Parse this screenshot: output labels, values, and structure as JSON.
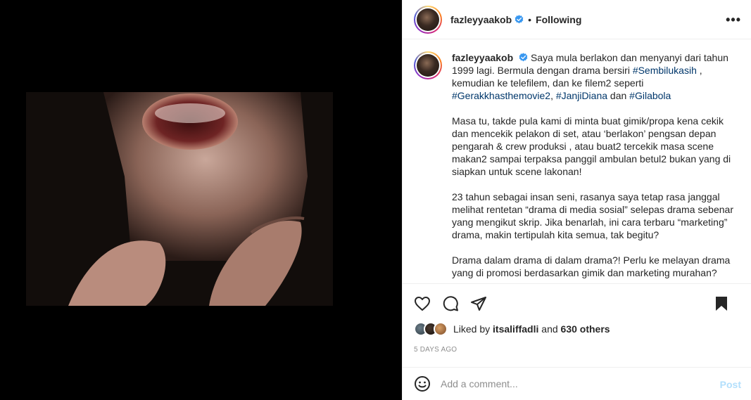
{
  "header": {
    "username": "fazleyyaakob",
    "separator": "•",
    "follow_status": "Following",
    "more_label": "•••"
  },
  "caption": {
    "username": "fazleyyaakob",
    "p1_a": "Saya mula berlakon dan menyanyi dari tahun 1999 lagi. Bermula dengan drama bersiri ",
    "p1_tag1": "#Sembilukasih",
    "p1_b": " , kemudian ke telefilem, dan ke filem2 seperti ",
    "p1_tag2": "#Gerakkhasthemovie2",
    "p1_c": ", ",
    "p1_tag3": "#JanjiDiana",
    "p1_d": " dan ",
    "p1_tag4": "#Gilabola",
    "p2": "Masa tu, takde pula kami di minta buat gimik/propa kena cekik dan mencekik pelakon di set, atau ‘berlakon’ pengsan depan pengarah & crew produksi , atau buat2 tercekik masa scene makan2 sampai terpaksa panggil ambulan betul2 bukan yang di siapkan untuk scene lakonan!",
    "p3": "23 tahun sebagai insan seni, rasanya saya tetap rasa janggal melihat rentetan “drama di media sosial” selepas drama sebenar yang mengikut skrip. Jika benarlah, ini cara terbaru “marketing” drama, makin tertipulah kita semua, tak begitu?",
    "p4": "Drama dalam drama di dalam drama?! Perlu ke melayan drama yang di promosi berdasarkan gimik dan marketing murahan?"
  },
  "likes": {
    "prefix": "Liked by ",
    "user": "itsaliffadli",
    "middle": " and ",
    "others": "630 others"
  },
  "timestamp": "5 DAYS AGO",
  "comment_box": {
    "placeholder": "Add a comment...",
    "post_label": "Post"
  },
  "colors": {
    "link": "#00376b",
    "verified": "#3897f0",
    "post_disabled": "#b2dffc",
    "muted": "#8e8e8e"
  }
}
